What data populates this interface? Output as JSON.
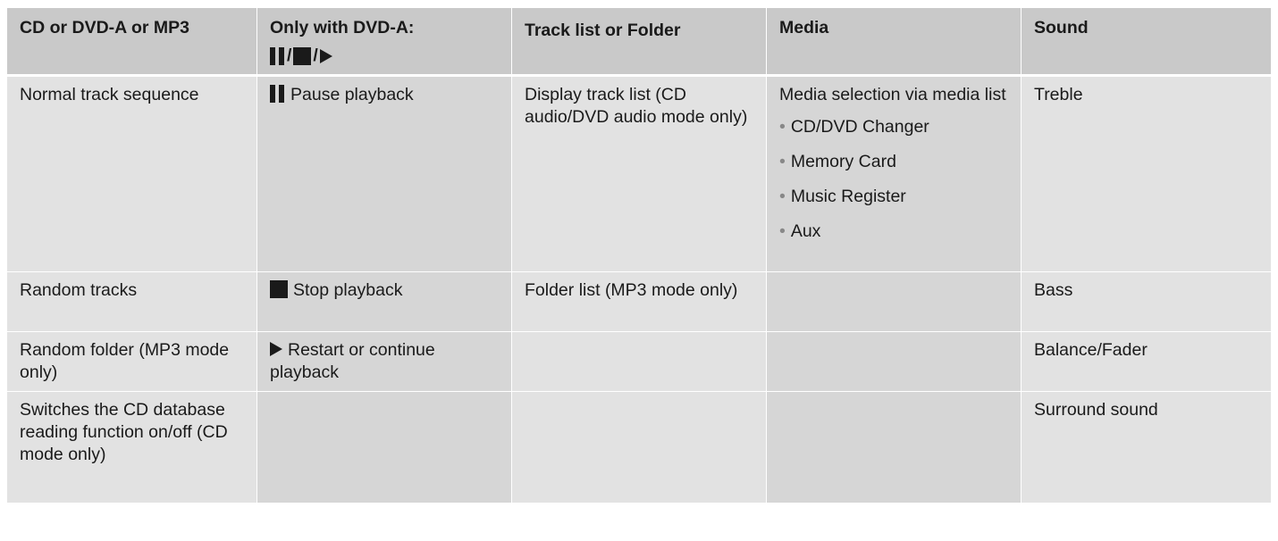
{
  "table": {
    "headers": {
      "col1": "CD or DVD-A or MP3",
      "col2": "Only with DVD-A:",
      "col2_symbols": [
        "pause-icon",
        "stop-icon",
        "play-icon"
      ],
      "col2_separator": "/",
      "col3": "Track list or Folder",
      "col4": "Media",
      "col5": "Sound"
    },
    "rows": [
      {
        "col1": "Normal track sequence",
        "col2": "Pause playback",
        "col2_icon": "pause-icon",
        "col3": "Display track list (CD audio/DVD audio mode only)",
        "col4": "Media selection via media list",
        "col4_items": [
          "CD/DVD Changer",
          "Memory Card",
          "Music Register",
          "Aux"
        ],
        "col5": "Treble"
      },
      {
        "col1": "Random tracks",
        "col2": "Stop playback",
        "col2_icon": "stop-icon",
        "col3": "Folder list (MP3 mode only)",
        "col4": "",
        "col5": "Bass"
      },
      {
        "col1": "Random folder (MP3 mode only)",
        "col2": "Restart or continue playback",
        "col2_icon": "play-icon",
        "col3": "",
        "col4": "",
        "col5": "Balance/Fader"
      },
      {
        "col1": "Switches the CD database reading function on/off (CD mode only)",
        "col2": "",
        "col3": "",
        "col4": "",
        "col5": "Surround sound"
      }
    ]
  }
}
